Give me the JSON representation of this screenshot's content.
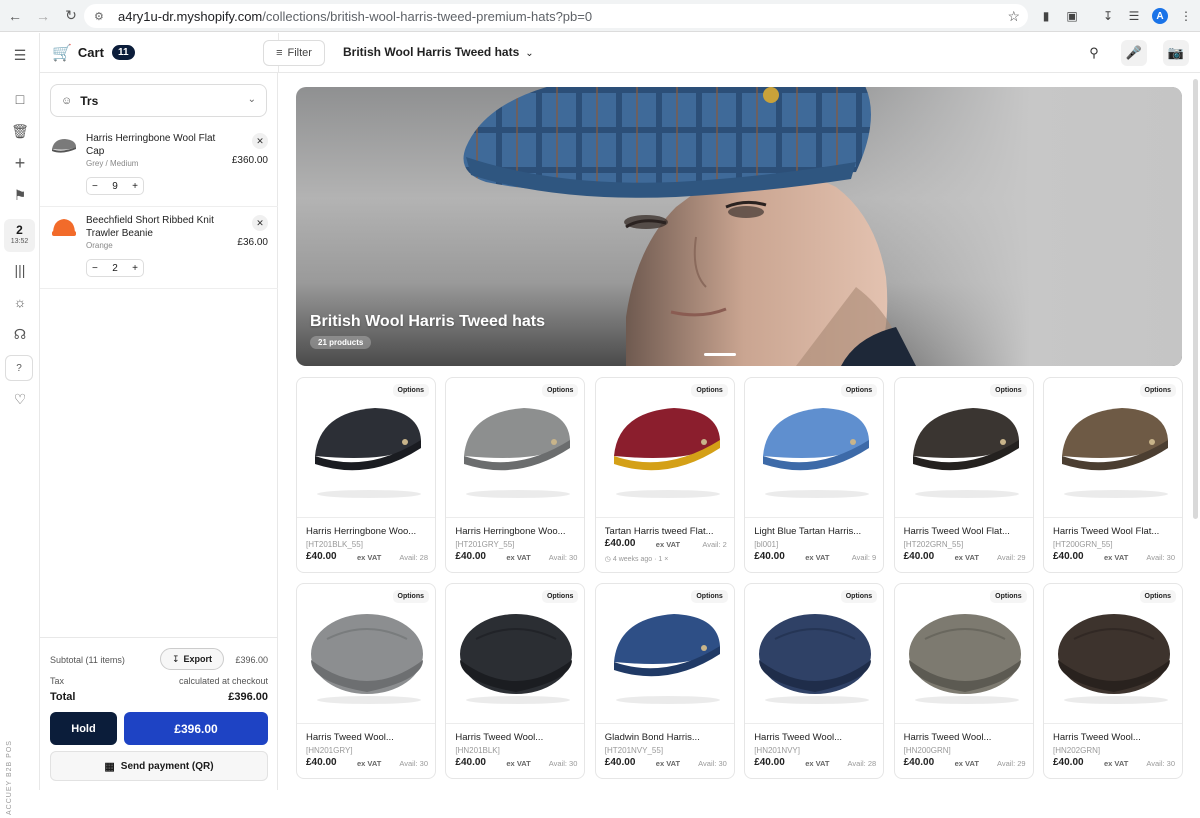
{
  "browser": {
    "url_host": "a4ry1u-dr.myshopify.com",
    "url_path": "/collections/british-wool-harris-tweed-premium-hats?pb=0",
    "profile_initial": "A"
  },
  "rail": {
    "session_number": "2",
    "session_time": "13:52",
    "help_label": "?",
    "vertical_label": "ACCUEY B2B POS"
  },
  "cart": {
    "label": "Cart",
    "count": "11",
    "customer": "Trs",
    "items": [
      {
        "name": "Harris Herringbone Wool Flat Cap",
        "variant": "Grey / Medium",
        "price": "£360.00",
        "qty": "9",
        "color": "#7a7a7a"
      },
      {
        "name": "Beechfield Short Ribbed Knit Trawler Beanie",
        "variant": "Orange",
        "price": "£36.00",
        "qty": "2",
        "color": "#f26b2a"
      }
    ],
    "subtotal_label": "Subtotal (11 items)",
    "export_label": "Export",
    "subtotal_value": "£396.00",
    "tax_label": "Tax",
    "tax_value": "calculated at checkout",
    "total_label": "Total",
    "total_value": "£396.00",
    "hold_label": "Hold",
    "pay_label": "£396.00",
    "qr_label": "Send payment (QR)"
  },
  "topbar": {
    "filter_label": "Filter",
    "collection": "British Wool Harris Tweed hats"
  },
  "hero": {
    "title": "British Wool Harris Tweed hats",
    "count": "21 products"
  },
  "products": [
    {
      "name": "Harris Herringbone Woo...",
      "sku": "[HT201BLK_55]",
      "price": "£40.00",
      "vat": "ex VAT",
      "avail": "Avail: 28",
      "style": "flat",
      "c1": "#2c2f36",
      "c2": "#1a1c21"
    },
    {
      "name": "Harris Herringbone Woo...",
      "sku": "[HT201GRY_55]",
      "price": "£40.00",
      "vat": "ex VAT",
      "avail": "Avail: 30",
      "style": "flat",
      "c1": "#8d8f8f",
      "c2": "#6b6d6e"
    },
    {
      "name": "Tartan Harris tweed Flat...",
      "sku": "",
      "price": "£40.00",
      "vat": "ex VAT",
      "avail": "Avail: 2",
      "recent": "4 weeks ago · 1 ×",
      "style": "flat",
      "c1": "#8b1e2d",
      "c2": "#d4a017"
    },
    {
      "name": "Light Blue Tartan Harris...",
      "sku": "[bl001]",
      "price": "£40.00",
      "vat": "ex VAT",
      "avail": "Avail: 9",
      "style": "flat",
      "c1": "#5f8fcf",
      "c2": "#3d6aa8"
    },
    {
      "name": "Harris Tweed Wool Flat...",
      "sku": "[HT202GRN_55]",
      "price": "£40.00",
      "vat": "ex VAT",
      "avail": "Avail: 29",
      "style": "flat",
      "c1": "#3a3531",
      "c2": "#24211f"
    },
    {
      "name": "Harris Tweed Wool Flat...",
      "sku": "[HT200GRN_55]",
      "price": "£40.00",
      "vat": "ex VAT",
      "avail": "Avail: 30",
      "style": "flat",
      "c1": "#6e5a45",
      "c2": "#4b3e31"
    },
    {
      "name": "Harris Tweed Wool...",
      "sku": "[HN201GRY]",
      "price": "£40.00",
      "vat": "ex VAT",
      "avail": "Avail: 30",
      "style": "baker",
      "c1": "#8c8e90",
      "c2": "#6d6f71"
    },
    {
      "name": "Harris Tweed Wool...",
      "sku": "[HN201BLK]",
      "price": "£40.00",
      "vat": "ex VAT",
      "avail": "Avail: 30",
      "style": "baker",
      "c1": "#2b2e33",
      "c2": "#1b1d21"
    },
    {
      "name": "Gladwin Bond Harris...",
      "sku": "[HT201NVY_55]",
      "price": "£40.00",
      "vat": "ex VAT",
      "avail": "Avail: 30",
      "style": "flat",
      "c1": "#2e4f86",
      "c2": "#203a66"
    },
    {
      "name": "Harris Tweed Wool...",
      "sku": "[HN201NVY]",
      "price": "£40.00",
      "vat": "ex VAT",
      "avail": "Avail: 28",
      "style": "baker",
      "c1": "#2f4166",
      "c2": "#1f2d4a"
    },
    {
      "name": "Harris Tweed Wool...",
      "sku": "[HN200GRN]",
      "price": "£40.00",
      "vat": "ex VAT",
      "avail": "Avail: 29",
      "style": "baker",
      "c1": "#7d7a70",
      "c2": "#5c5a52"
    },
    {
      "name": "Harris Tweed Wool...",
      "sku": "[HN202GRN]",
      "price": "£40.00",
      "vat": "ex VAT",
      "avail": "Avail: 30",
      "style": "baker",
      "c1": "#3d332d",
      "c2": "#29221e"
    }
  ],
  "options_label": "Options"
}
